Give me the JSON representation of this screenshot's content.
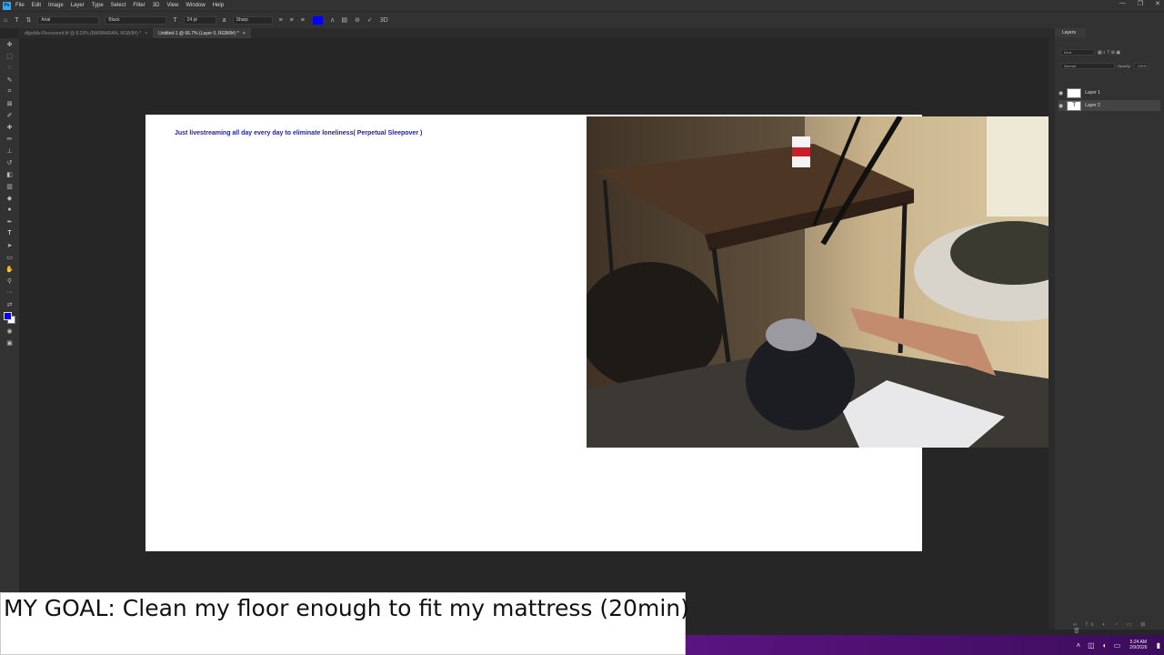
{
  "menubar": {
    "logo": "Ps",
    "items": [
      "File",
      "Edit",
      "Image",
      "Layer",
      "Type",
      "Select",
      "Filter",
      "3D",
      "View",
      "Window",
      "Help"
    ],
    "window_controls": [
      "—",
      "❐",
      "✕"
    ]
  },
  "optionsbar": {
    "font_family": "Arial",
    "font_style": "Black",
    "font_size": "24 pt",
    "antialias": "Sharp",
    "text_color": "#0000ff"
  },
  "tabs": [
    {
      "label": "dfgsfdfv-Recovered.tif @ 8.33% (BARBARIAN, RGB/8#) *",
      "active": false
    },
    {
      "label": "Untitled-1 @ 66.7% (Layer 0, RGB/8#) *",
      "active": true
    }
  ],
  "document": {
    "text": "Just livestreaming all day every day to eliminate loneliness( Perpetual Sleepover )"
  },
  "layers_panel": {
    "tab_label": "Layers",
    "kind_placeholder": "Kind",
    "blend_mode": "Normal",
    "opacity_label": "Opacity:",
    "opacity_value": "100%",
    "layers": [
      {
        "name": "Layer 1",
        "selected": false
      },
      {
        "name": "Layer 2",
        "selected": true
      }
    ]
  },
  "overlay": {
    "goal": "MY GOAL: Clean my floor enough to fit my mattress (20min)"
  },
  "taskbar": {
    "time": "5:24 AM",
    "date": "2/9/2026"
  },
  "colors": {
    "accent": "#31a8ff",
    "text_color_swatch": "#0000ff",
    "taskbar": "#4a1070"
  }
}
